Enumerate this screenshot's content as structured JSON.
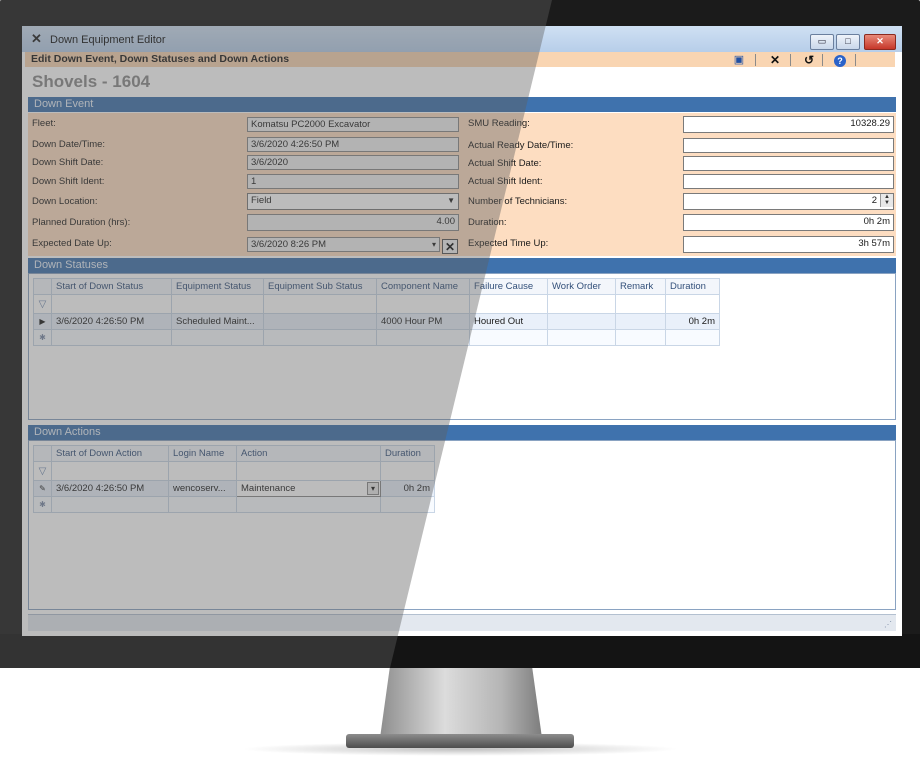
{
  "window": {
    "title": "Down Equipment Editor",
    "subheader": "Edit Down Event, Down Statuses and Down Actions",
    "page_title": "Shovels - 1604",
    "controls": [
      "minimize-icon",
      "maximize-icon",
      "close-icon"
    ]
  },
  "toolbar": {
    "icons": [
      "save-icon",
      "cancel-icon",
      "refresh-icon",
      "help-icon"
    ],
    "help_glyph": "?"
  },
  "down_event": {
    "section_title": "Down Event",
    "fleet_label": "Fleet:",
    "fleet_value": "Komatsu PC2000 Excavator",
    "down_datetime_label": "Down Date/Time:",
    "down_datetime_value": "3/6/2020 4:26:50 PM",
    "down_shift_date_label": "Down Shift Date:",
    "down_shift_date_value": "3/6/2020",
    "down_shift_ident_label": "Down Shift Ident:",
    "down_shift_ident_value": "1",
    "down_location_label": "Down Location:",
    "down_location_value": "Field",
    "planned_duration_label": "Planned Duration (hrs):",
    "planned_duration_value": "4.00",
    "expected_date_up_label": "Expected Date Up:",
    "expected_date_up_value": "3/6/2020 8:26 PM",
    "smu_reading_label": "SMU Reading:",
    "smu_reading_value": "10328.29",
    "actual_ready_label": "Actual Ready Date/Time:",
    "actual_ready_value": "",
    "actual_shift_date_label": "Actual Shift Date:",
    "actual_shift_date_value": "",
    "actual_shift_ident_label": "Actual Shift Ident:",
    "actual_shift_ident_value": "",
    "technicians_label": "Number of Technicians:",
    "technicians_value": "2",
    "duration_label": "Duration:",
    "duration_value": "0h 2m",
    "expected_time_up_label": "Expected Time Up:",
    "expected_time_up_value": "3h 57m"
  },
  "down_statuses": {
    "section_title": "Down Statuses",
    "columns": [
      "Start of Down Status",
      "Equipment Status",
      "Equipment Sub Status",
      "Component Name",
      "Failure Cause",
      "Work Order",
      "Remark",
      "Duration"
    ],
    "rows": [
      {
        "start": "3/6/2020 4:26:50 PM",
        "equipment_status": "Scheduled Maint...",
        "sub_status": "",
        "component": "4000 Hour PM",
        "failure_cause": "Houred Out",
        "work_order": "",
        "remark": "",
        "duration": "0h 2m"
      }
    ]
  },
  "down_actions": {
    "section_title": "Down Actions",
    "columns": [
      "Start of Down Action",
      "Login Name",
      "Action",
      "Duration"
    ],
    "rows": [
      {
        "start": "3/6/2020 4:26:50 PM",
        "login": "wencoserv...",
        "action": "Maintenance",
        "duration": "0h 2m"
      }
    ]
  },
  "colors": {
    "section_bar": "#3f72ad",
    "form_background": "#fdddc1",
    "subheader_background": "#f9d5b2"
  }
}
